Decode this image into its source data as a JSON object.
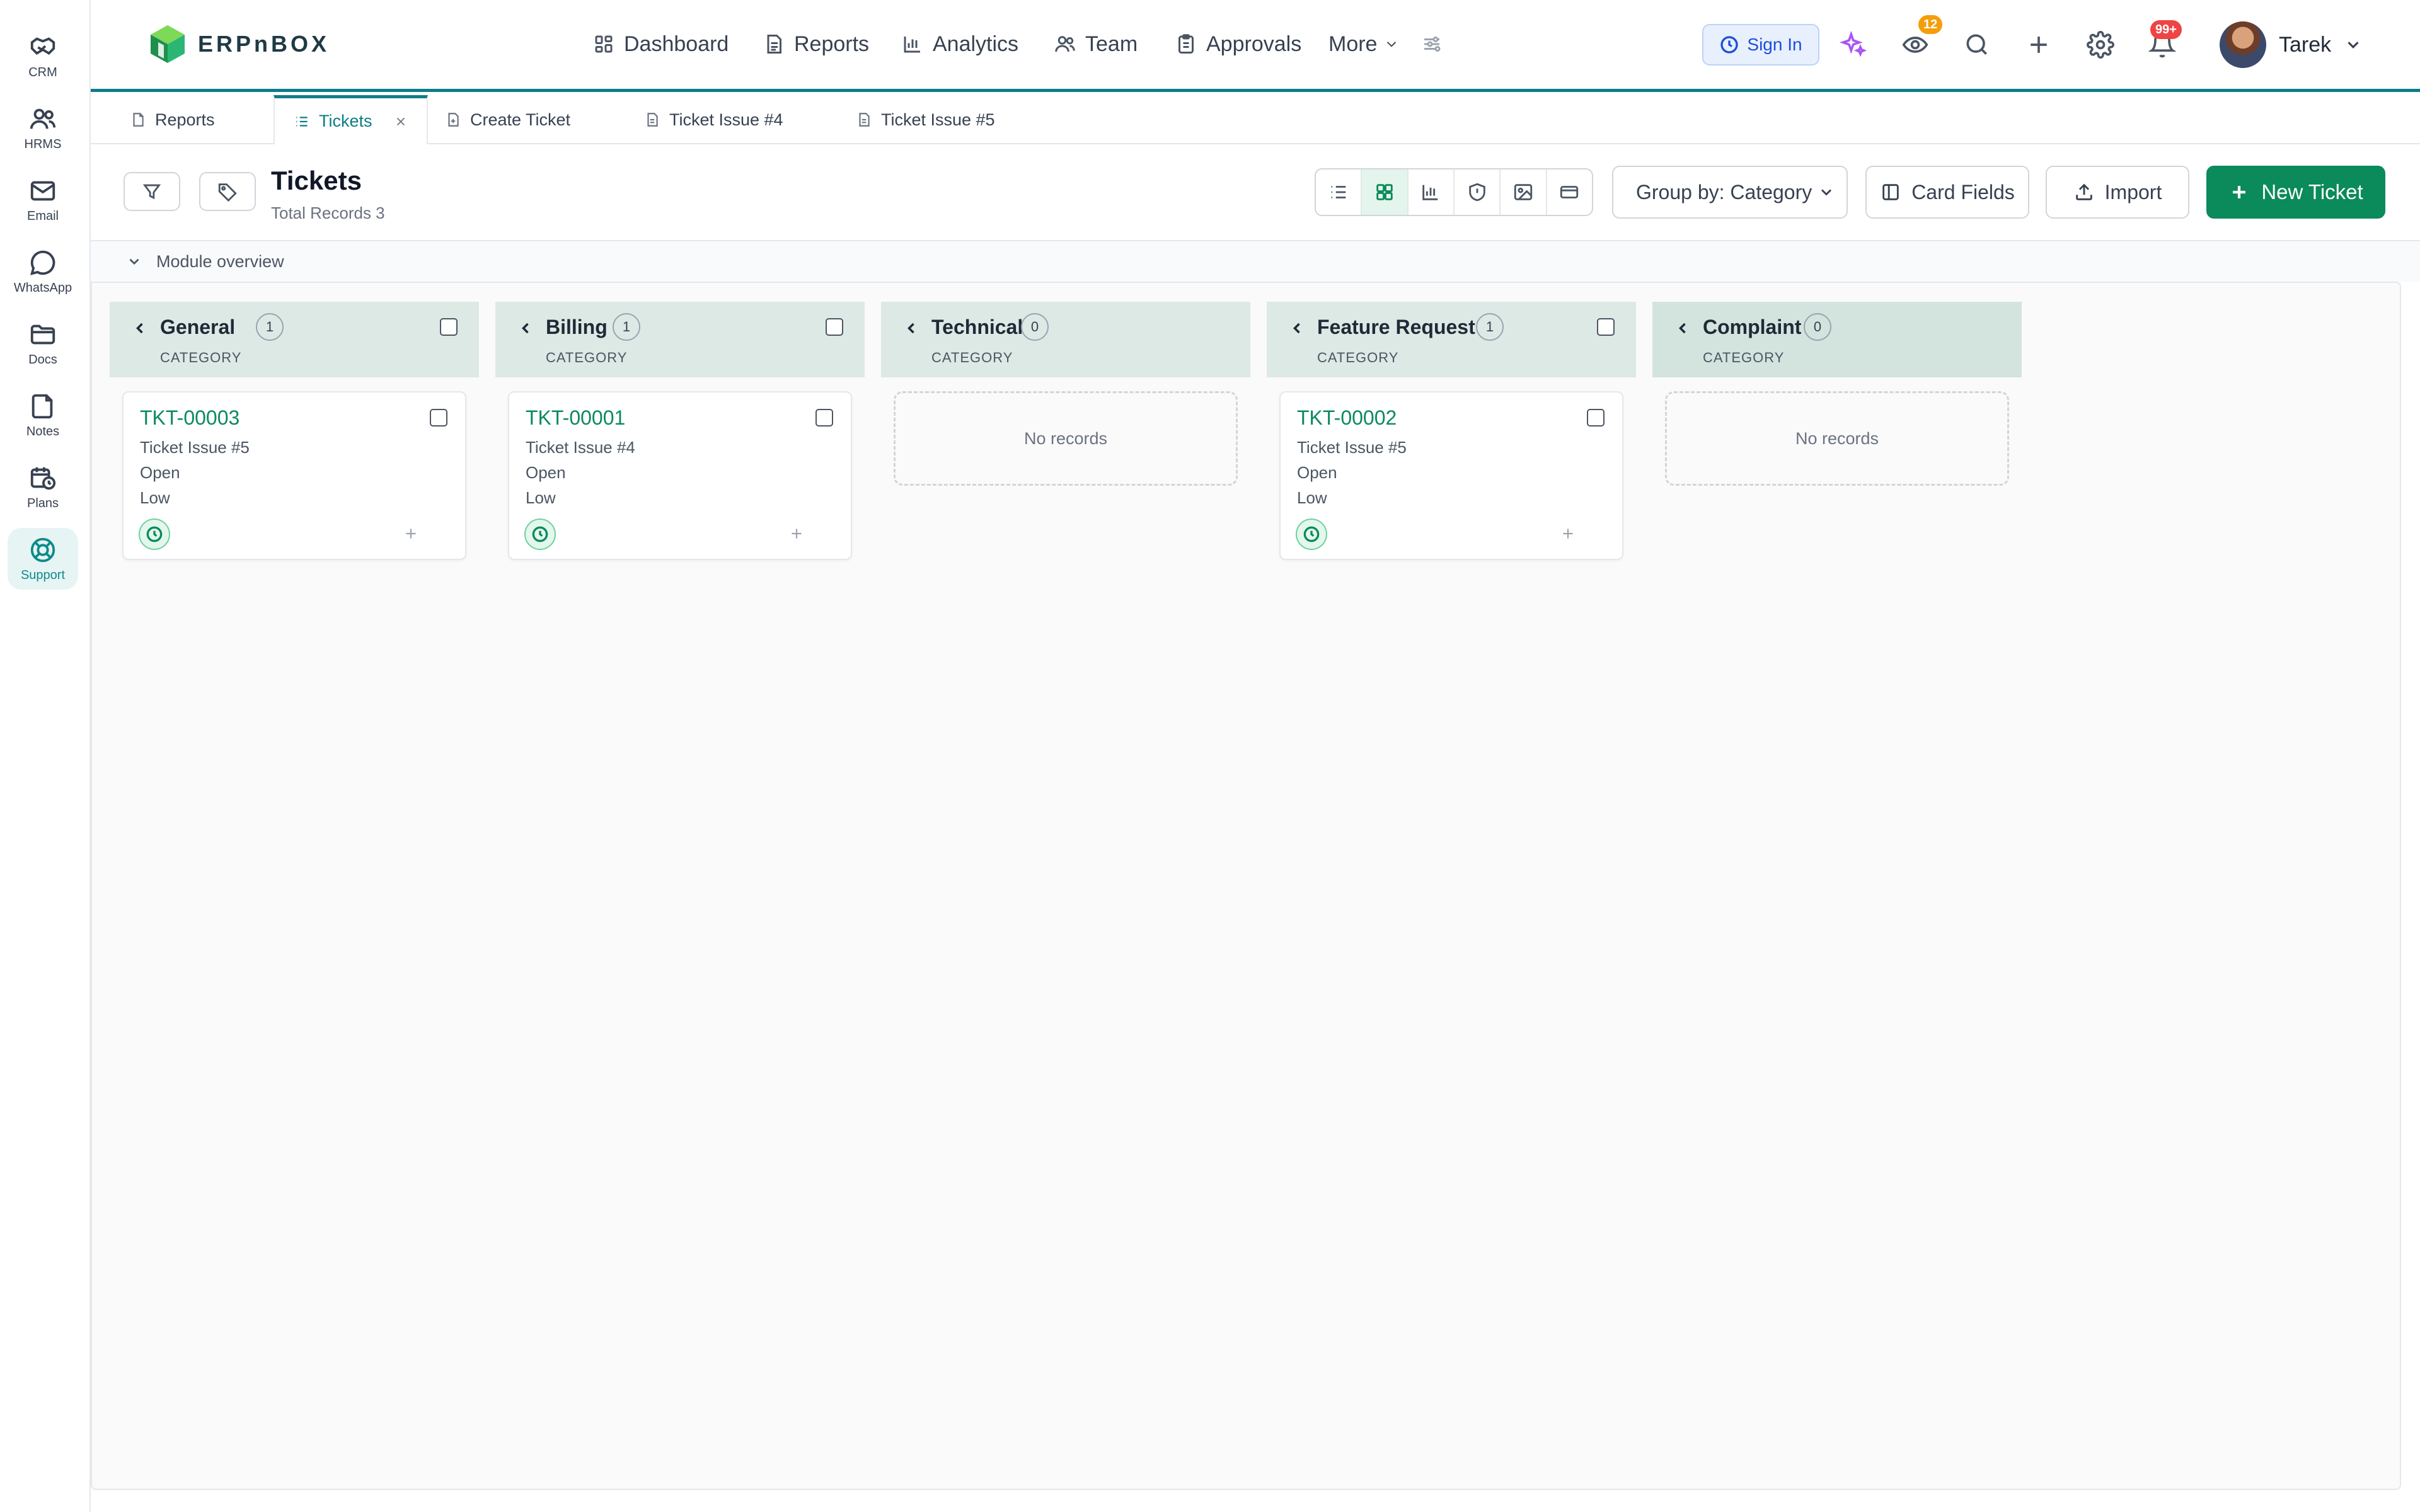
{
  "sidebar": {
    "items": [
      {
        "label": "CRM",
        "icon": "handshake-icon"
      },
      {
        "label": "HRMS",
        "icon": "users-icon"
      },
      {
        "label": "Email",
        "icon": "mail-icon"
      },
      {
        "label": "WhatsApp",
        "icon": "chat-bubble-icon"
      },
      {
        "label": "Docs",
        "icon": "folder-icon"
      },
      {
        "label": "Notes",
        "icon": "note-icon"
      },
      {
        "label": "Plans",
        "icon": "calendar-clock-icon"
      },
      {
        "label": "Support",
        "icon": "lifebuoy-icon",
        "active": true
      }
    ]
  },
  "header": {
    "logo_text": "ERPnBOX",
    "nav": [
      {
        "label": "Dashboard",
        "icon": "grid-icon"
      },
      {
        "label": "Reports",
        "icon": "document-icon"
      },
      {
        "label": "Analytics",
        "icon": "bar-chart-icon"
      },
      {
        "label": "Team",
        "icon": "users-icon"
      },
      {
        "label": "Approvals",
        "icon": "clipboard-icon"
      },
      {
        "label": "More",
        "icon": "chevron-down-icon"
      }
    ],
    "sign_in_label": "Sign In",
    "watch_badge": "12",
    "notification_badge": "99+",
    "user_name": "Tarek",
    "accent_color": "#0e7c86"
  },
  "tabs": [
    {
      "label": "Reports",
      "icon": "document-icon"
    },
    {
      "label": "Tickets",
      "icon": "list-icon",
      "active": true,
      "closable": true
    },
    {
      "label": "Create Ticket",
      "icon": "document-plus-icon"
    },
    {
      "label": "Ticket Issue #4",
      "icon": "document-icon"
    },
    {
      "label": "Ticket Issue #5",
      "icon": "document-icon"
    }
  ],
  "toolbar": {
    "title": "Tickets",
    "subtitle": "Total Records 3",
    "group_by": "Group by: Category",
    "card_fields_label": "Card Fields",
    "import_label": "Import",
    "new_ticket_label": "New Ticket",
    "views": [
      "list-view-icon",
      "kanban-view-icon",
      "chart-view-icon",
      "shield-view-icon",
      "gallery-view-icon",
      "card-view-icon"
    ],
    "active_view": "kanban",
    "primary_color": "#0b8a5b"
  },
  "module_overview_label": "Module overview",
  "board": {
    "columns": [
      {
        "title": "General",
        "count": "1",
        "subtitle": "CATEGORY",
        "cards": [
          {
            "id": "TKT-00003",
            "subject": "Ticket Issue #5",
            "status": "Open",
            "priority": "Low"
          }
        ]
      },
      {
        "title": "Billing",
        "count": "1",
        "subtitle": "CATEGORY",
        "cards": [
          {
            "id": "TKT-00001",
            "subject": "Ticket Issue #4",
            "status": "Open",
            "priority": "Low"
          }
        ]
      },
      {
        "title": "Technical",
        "count": "0",
        "subtitle": "CATEGORY",
        "empty_text": "No records",
        "cards": []
      },
      {
        "title": "Feature Request",
        "count": "1",
        "subtitle": "CATEGORY",
        "cards": [
          {
            "id": "TKT-00002",
            "subject": "Ticket Issue #5",
            "status": "Open",
            "priority": "Low"
          }
        ]
      },
      {
        "title": "Complaint",
        "count": "0",
        "subtitle": "CATEGORY",
        "empty_text": "No records",
        "cards": []
      }
    ]
  }
}
